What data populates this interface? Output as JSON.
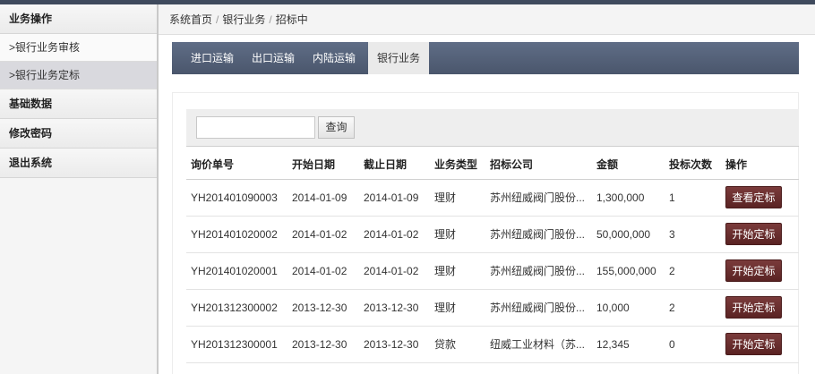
{
  "sidebar": {
    "groups": [
      {
        "label": "业务操作",
        "items": [
          {
            "label": ">银行业务审核"
          },
          {
            "label": ">银行业务定标"
          }
        ]
      },
      {
        "label": "基础数据"
      },
      {
        "label": "修改密码"
      },
      {
        "label": "退出系统"
      }
    ]
  },
  "breadcrumb": [
    "系统首页",
    "银行业务",
    "招标中"
  ],
  "tabs": [
    {
      "label": "进口运输"
    },
    {
      "label": "出口运输"
    },
    {
      "label": "内陆运输"
    },
    {
      "label": "银行业务"
    }
  ],
  "search": {
    "value": "",
    "placeholder": "",
    "button_label": "查询"
  },
  "table": {
    "headers": [
      "询价单号",
      "开始日期",
      "截止日期",
      "业务类型",
      "招标公司",
      "金额",
      "投标次数",
      "操作"
    ],
    "rows": [
      [
        "YH201401090003",
        "2014-01-09",
        "2014-01-09",
        "理财",
        "苏州纽威阀门股份...",
        "1,300,000",
        "1",
        "查看定标"
      ],
      [
        "YH201401020002",
        "2014-01-02",
        "2014-01-02",
        "理财",
        "苏州纽威阀门股份...",
        "50,000,000",
        "3",
        "开始定标"
      ],
      [
        "YH201401020001",
        "2014-01-02",
        "2014-01-02",
        "理财",
        "苏州纽威阀门股份...",
        "155,000,000",
        "2",
        "开始定标"
      ],
      [
        "YH201312300002",
        "2013-12-30",
        "2013-12-30",
        "理财",
        "苏州纽威阀门股份...",
        "10,000",
        "2",
        "开始定标"
      ],
      [
        "YH201312300001",
        "2013-12-30",
        "2013-12-30",
        "贷款",
        "纽威工业材料（苏...",
        "12,345",
        "0",
        "开始定标"
      ]
    ]
  },
  "colors": {
    "nav_dark": "#4a566c",
    "action_button": "#6a2d2d"
  }
}
